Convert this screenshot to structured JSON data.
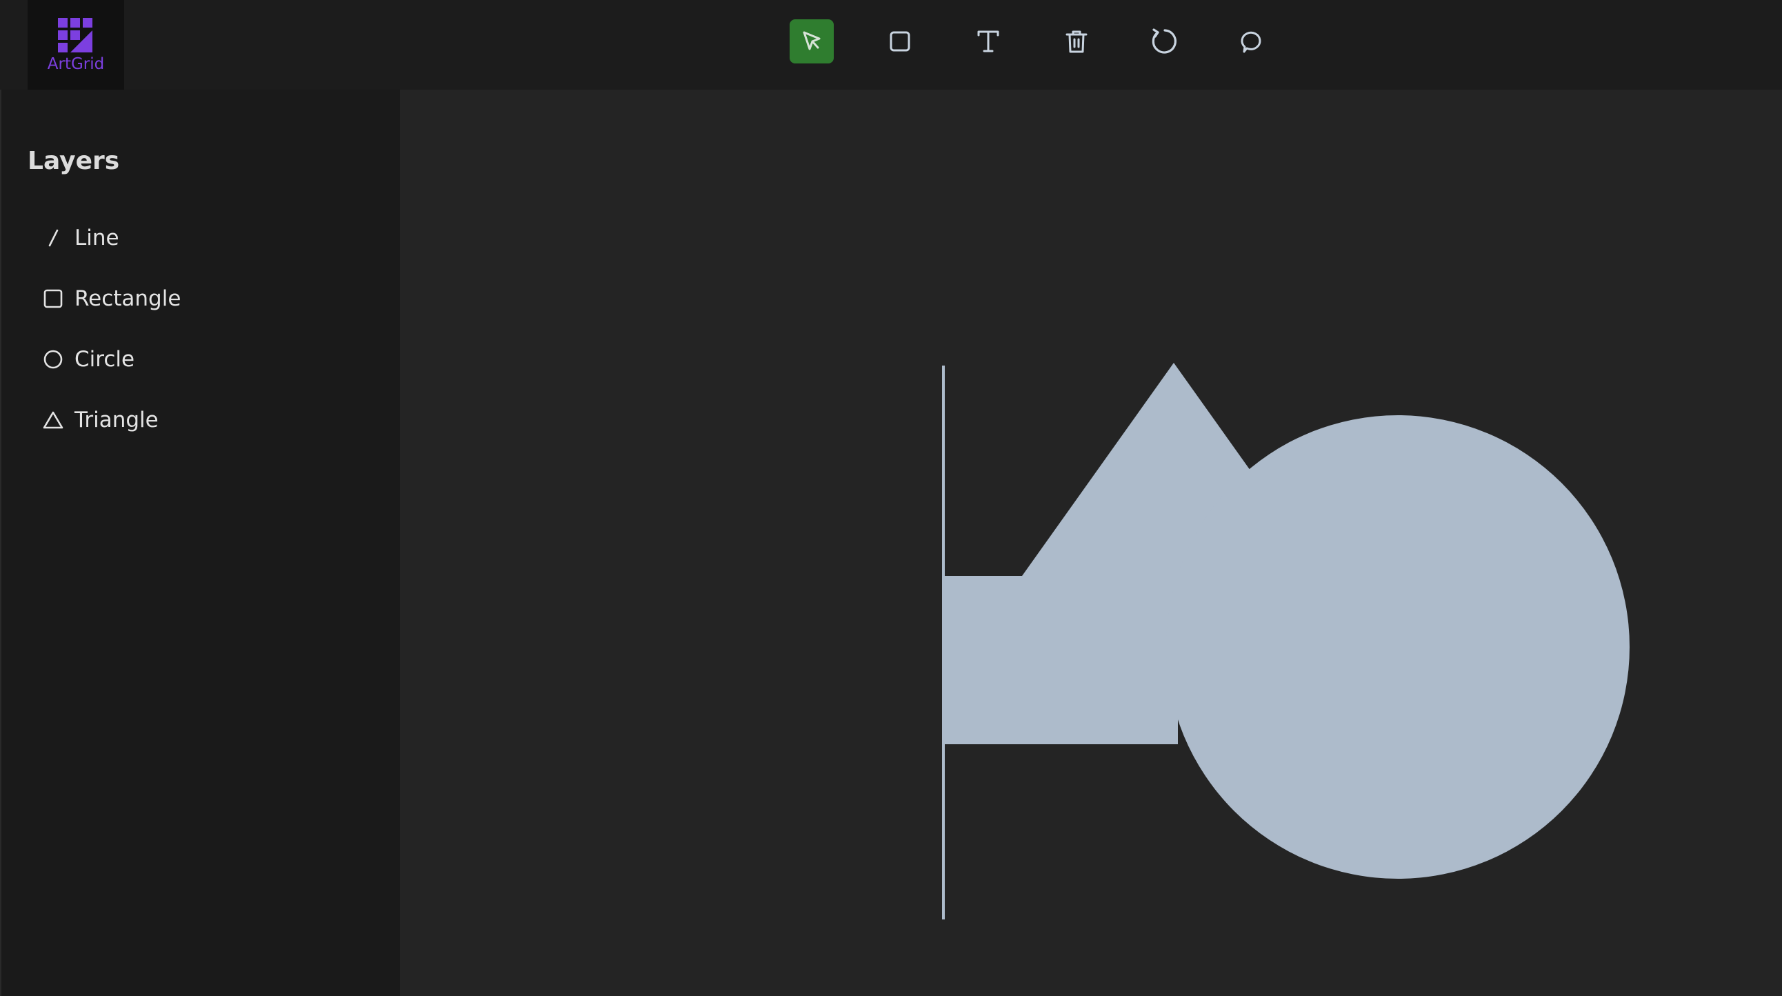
{
  "app": {
    "name": "ArtGrid",
    "brand_color": "#7c3fe0"
  },
  "toolbar": {
    "tools": [
      {
        "name": "select",
        "icon": "cursor-arrow-icon",
        "active": true
      },
      {
        "name": "rectangle",
        "icon": "square-icon",
        "active": false
      },
      {
        "name": "text",
        "icon": "text-t-icon",
        "active": false
      },
      {
        "name": "delete",
        "icon": "trash-icon",
        "active": false
      },
      {
        "name": "reset",
        "icon": "rotate-icon",
        "active": false
      },
      {
        "name": "comment",
        "icon": "speech-bubble-icon",
        "active": false
      }
    ],
    "active_color": "#2f7d2f"
  },
  "sidebar": {
    "title": "Layers",
    "items": [
      {
        "label": "Line",
        "icon": "line-icon"
      },
      {
        "label": "Rectangle",
        "icon": "square-icon"
      },
      {
        "label": "Circle",
        "icon": "circle-icon"
      },
      {
        "label": "Triangle",
        "icon": "triangle-icon"
      }
    ]
  },
  "canvas": {
    "shape_fill": "#adbbcb",
    "background": "#242424"
  }
}
